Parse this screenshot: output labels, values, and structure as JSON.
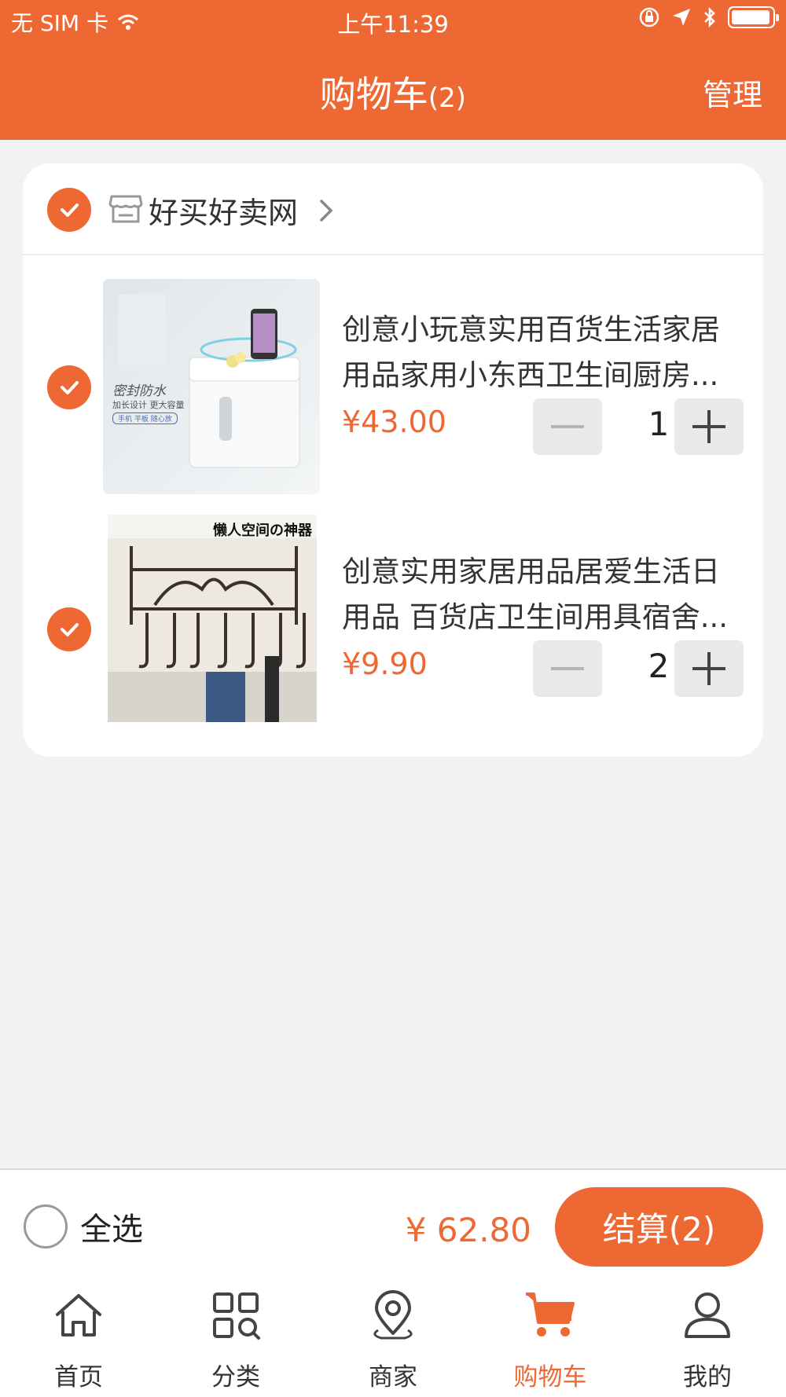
{
  "status_bar": {
    "carrier": "无 SIM 卡",
    "time": "上午11:39"
  },
  "nav": {
    "title": "购物车",
    "count": "(2)",
    "manage": "管理"
  },
  "cart": {
    "shop_name": "好买好卖网",
    "items": [
      {
        "title_line1": "创意小玩意实用百货生活家居",
        "title_line2": "用品家用小东西卫生间厨房...",
        "price": "¥43.00",
        "quantity": "1",
        "image_text_1": "密封防水",
        "image_text_2": "加长设计 更大容量",
        "image_text_3": "手机 平板 随心放"
      },
      {
        "title_line1": "创意实用家居用品居爱生活日",
        "title_line2": "用品 百货店卫生间用具宿舍...",
        "price": "¥9.90",
        "quantity": "2",
        "image_text_1": "懒人空间の神器"
      }
    ]
  },
  "footer": {
    "select_all": "全选",
    "total": "¥ 62.80",
    "checkout": "结算(2)"
  },
  "tabs": [
    {
      "label": "首页",
      "icon": "home-icon"
    },
    {
      "label": "分类",
      "icon": "category-icon"
    },
    {
      "label": "商家",
      "icon": "location-pin-icon"
    },
    {
      "label": "购物车",
      "icon": "cart-icon"
    },
    {
      "label": "我的",
      "icon": "user-icon"
    }
  ],
  "colors": {
    "accent": "#ee6833",
    "background": "#f2f2f2"
  }
}
